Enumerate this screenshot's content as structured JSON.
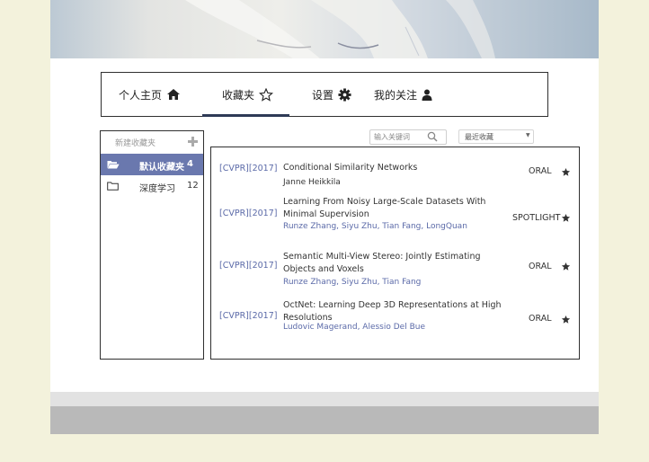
{
  "nav": {
    "items": [
      {
        "label": "个人主页",
        "icon": "home-icon"
      },
      {
        "label": "收藏夹",
        "icon": "star-outline-icon"
      },
      {
        "label": "设置",
        "icon": "gear-icon"
      },
      {
        "label": "我的关注",
        "icon": "user-icon"
      }
    ],
    "active_index": 1
  },
  "sidebar": {
    "new_label": "新建收藏夹",
    "folders": [
      {
        "name": "默认收藏夹",
        "count": "4",
        "active": true
      },
      {
        "name": "深度学习",
        "count": "12",
        "active": false
      }
    ]
  },
  "search": {
    "placeholder": "输入关键词",
    "value": ""
  },
  "sort": {
    "selected": "最近收藏"
  },
  "papers": [
    {
      "venue": "[CVPR][2017]",
      "title": "Conditional Similarity Networks",
      "authors": "Janne Heikkila",
      "tag": "ORAL"
    },
    {
      "venue": "[CVPR][2017]",
      "title": "Learning From Noisy Large-Scale Datasets With Minimal Supervision",
      "authors": "Runze Zhang, Siyu Zhu, Tian Fang, LongQuan",
      "tag": "SPOTLIGHT"
    },
    {
      "venue": "[CVPR][2017]",
      "title": "Semantic Multi-View Stereo: Jointly Estimating Objects and Voxels",
      "authors": "Runze Zhang, Siyu Zhu, Tian Fang",
      "tag": "ORAL"
    },
    {
      "venue": "[CVPR][2017]",
      "title": "OctNet: Learning Deep 3D Representations at High Resolutions",
      "authors": "Ludovic Magerand, Alessio Del Bue",
      "tag": "ORAL"
    }
  ],
  "colors": {
    "accent": "#6a78ae",
    "link": "#5b6aa8",
    "nav_underline": "#2e3a56",
    "background": "#f3f2dc"
  }
}
